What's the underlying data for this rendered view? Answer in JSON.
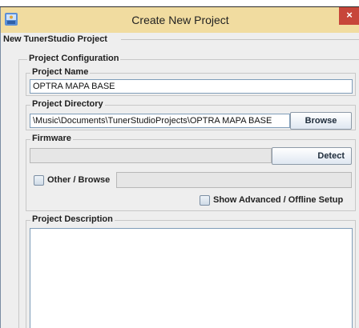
{
  "window": {
    "title": "Create New Project",
    "close_glyph": "×"
  },
  "outer_group": {
    "title": "New TunerStudio Project"
  },
  "config_group": {
    "title": "Project Configuration"
  },
  "project_name": {
    "title": "Project Name",
    "value": "OPTRA MAPA BASE"
  },
  "project_directory": {
    "title": "Project Directory",
    "value": "\\Music\\Documents\\TunerStudioProjects\\OPTRA MAPA BASE",
    "browse_label": "Browse"
  },
  "firmware": {
    "title": "Firmware",
    "value": "",
    "detect_label": "Detect",
    "other_browse_label": "Other / Browse",
    "other_browse_checked": false,
    "other_browse_value": "",
    "show_advanced_label": "Show Advanced / Offline Setup",
    "show_advanced_checked": false
  },
  "description": {
    "title": "Project Description",
    "value": ""
  },
  "icons": {
    "app": "tunerstudio-app-icon",
    "close": "close-icon"
  },
  "colors": {
    "titlebar": "#f1dca0",
    "close_button": "#c7463a",
    "panel": "#eeeeee",
    "field_border": "#7f9db9"
  }
}
